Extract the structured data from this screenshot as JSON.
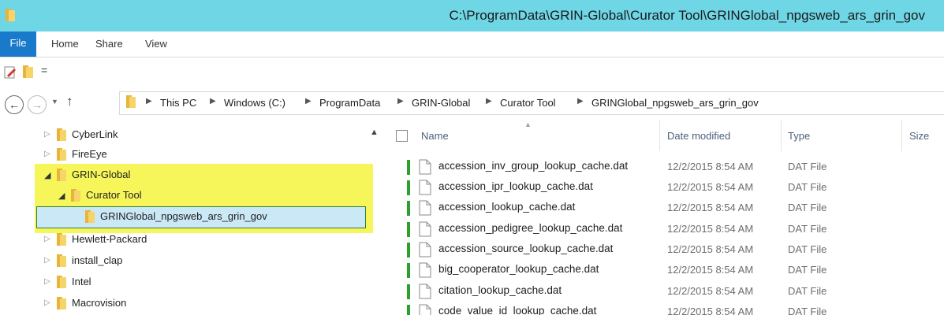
{
  "window": {
    "title": "C:\\ProgramData\\GRIN-Global\\Curator Tool\\GRINGlobal_npgsweb_ars_grin_gov"
  },
  "ribbon": {
    "tabs": [
      "File",
      "Home",
      "Share",
      "View"
    ]
  },
  "quick_access": {
    "dropdown_glyph": "="
  },
  "address_bar": {
    "breadcrumbs": [
      "This PC",
      "Windows (C:)",
      "ProgramData",
      "GRIN-Global",
      "Curator Tool",
      "GRINGlobal_npgsweb_ars_grin_gov"
    ]
  },
  "nav_tree": {
    "items": [
      {
        "label": "CyberLink",
        "expanded": false
      },
      {
        "label": "FireEye",
        "expanded": false
      },
      {
        "label": "GRIN-Global",
        "expanded": true
      },
      {
        "label": "Curator Tool",
        "expanded": true
      },
      {
        "label": "GRINGlobal_npgsweb_ars_grin_gov",
        "selected": true
      },
      {
        "label": "Hewlett-Packard",
        "expanded": false
      },
      {
        "label": "install_clap",
        "expanded": false
      },
      {
        "label": "Intel",
        "expanded": false
      },
      {
        "label": "Macrovision",
        "expanded": false
      }
    ]
  },
  "file_list": {
    "columns": [
      "Name",
      "Date modified",
      "Type",
      "Size"
    ],
    "rows": [
      {
        "name": "accession_inv_group_lookup_cache.dat",
        "date": "12/2/2015 8:54 AM",
        "type": "DAT File"
      },
      {
        "name": "accession_ipr_lookup_cache.dat",
        "date": "12/2/2015 8:54 AM",
        "type": "DAT File"
      },
      {
        "name": "accession_lookup_cache.dat",
        "date": "12/2/2015 8:54 AM",
        "type": "DAT File"
      },
      {
        "name": "accession_pedigree_lookup_cache.dat",
        "date": "12/2/2015 8:54 AM",
        "type": "DAT File"
      },
      {
        "name": "accession_source_lookup_cache.dat",
        "date": "12/2/2015 8:54 AM",
        "type": "DAT File"
      },
      {
        "name": "big_cooperator_lookup_cache.dat",
        "date": "12/2/2015 8:54 AM",
        "type": "DAT File"
      },
      {
        "name": "citation_lookup_cache.dat",
        "date": "12/2/2015 8:54 AM",
        "type": "DAT File"
      },
      {
        "name": "code_value_id_lookup_cache.dat",
        "date": "12/2/2015 8:54 AM",
        "type": "DAT File"
      }
    ]
  },
  "colors": {
    "titlebar": "#6fd6e6",
    "file_tab": "#1979ca",
    "highlight_yellow": "#f4f43e",
    "sync_green": "#2ca02c"
  },
  "icons": {
    "folder": "folder-icon",
    "file": "file-icon",
    "properties": "properties-icon",
    "new_folder": "new-folder-icon",
    "back": "back-arrow-icon",
    "forward": "forward-arrow-icon",
    "up": "up-arrow-icon",
    "expand": "expand-triangle-icon",
    "collapse": "collapse-triangle-icon",
    "sync_status": "sync-status-icon"
  }
}
